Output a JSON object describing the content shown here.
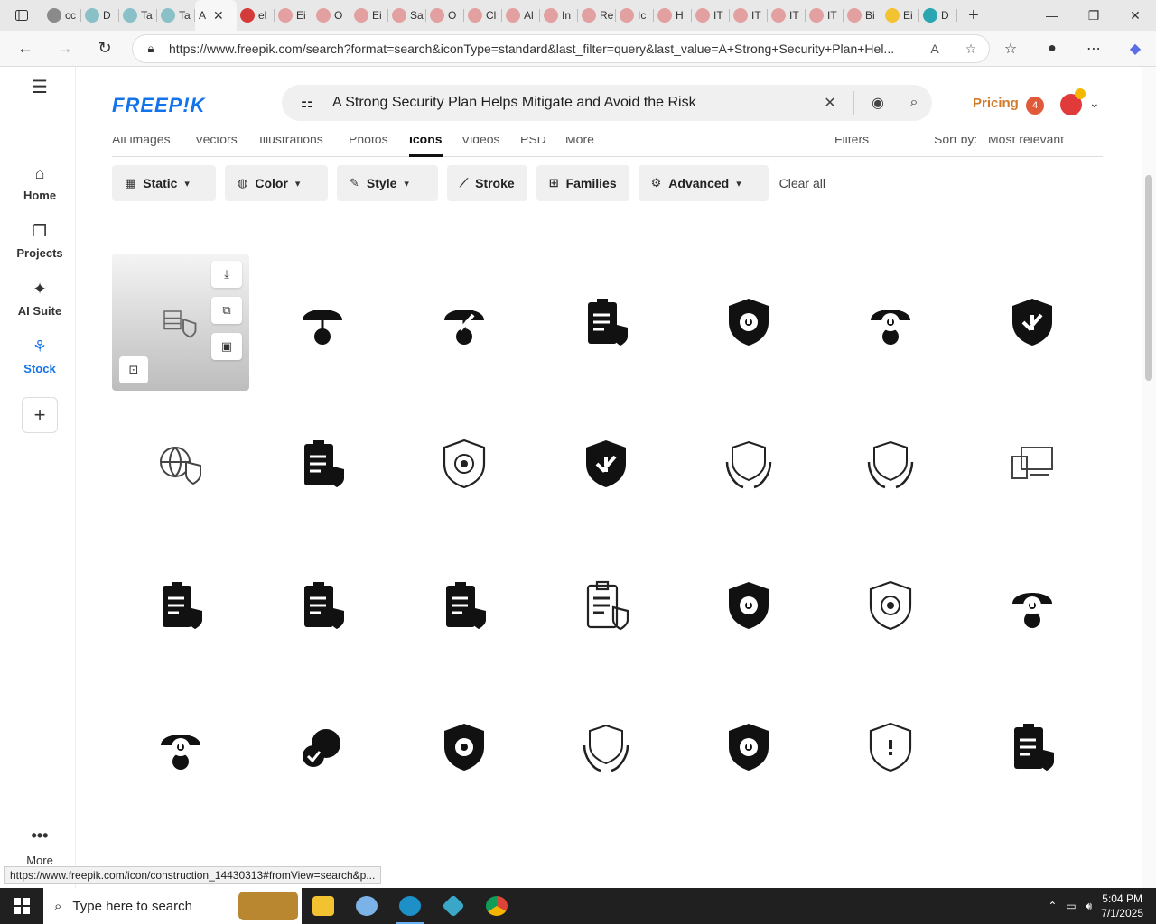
{
  "browser": {
    "tabs": [
      {
        "label": "cc",
        "color": "#8a8a8a"
      },
      {
        "label": "D",
        "color": "#8ac0c8"
      },
      {
        "label": "Ta",
        "color": "#8ac0c8"
      },
      {
        "label": "Ta",
        "color": "#8ac0c8"
      },
      {
        "label": "A",
        "color": "#ffffff",
        "active": true
      },
      {
        "label": "el",
        "color": "#d33a3a"
      },
      {
        "label": "Ei",
        "color": "#e3a0a0"
      },
      {
        "label": "O",
        "color": "#e3a0a0"
      },
      {
        "label": "Ei",
        "color": "#e3a0a0"
      },
      {
        "label": "Sa",
        "color": "#e3a0a0"
      },
      {
        "label": "O",
        "color": "#e3a0a0"
      },
      {
        "label": "Cl",
        "color": "#e3a0a0"
      },
      {
        "label": "Al",
        "color": "#e3a0a0"
      },
      {
        "label": "In",
        "color": "#e3a0a0"
      },
      {
        "label": "Re",
        "color": "#e3a0a0"
      },
      {
        "label": "Ic",
        "color": "#e3a0a0"
      },
      {
        "label": "H",
        "color": "#e3a0a0"
      },
      {
        "label": "IT",
        "color": "#e3a0a0"
      },
      {
        "label": "IT",
        "color": "#e3a0a0"
      },
      {
        "label": "IT",
        "color": "#e3a0a0"
      },
      {
        "label": "IT",
        "color": "#e3a0a0"
      },
      {
        "label": "Bi",
        "color": "#e3a0a0"
      },
      {
        "label": "Ei",
        "color": "#f2c230"
      },
      {
        "label": "D",
        "color": "#2aa6b0"
      }
    ],
    "new_tab": "+",
    "url": "https://www.freepik.com/search?format=search&iconType=standard&last_filter=query&last_value=A+Strong+Security+Plan+Hel...",
    "status_url": "https://www.freepik.com/icon/construction_14430313#fromView=search&p..."
  },
  "sidebar": {
    "items": [
      {
        "label": "Home",
        "icon": "⌂"
      },
      {
        "label": "Projects",
        "icon": "❐"
      },
      {
        "label": "AI Suite",
        "icon": "✦"
      },
      {
        "label": "Stock",
        "icon": "⚘"
      }
    ],
    "more_label": "More",
    "accent": "#1273eb"
  },
  "header": {
    "logo": "FREEP!K",
    "search_value": "A Strong Security Plan Helps Mitigate and Avoid the Risk",
    "pricing": "Pricing",
    "notif_count": "4"
  },
  "subtabs": {
    "items": [
      "All images",
      "Vectors",
      "Illustrations",
      "Photos",
      "Icons",
      "Videos",
      "PSD",
      "More"
    ],
    "active": "Icons",
    "filters_label": "Filters",
    "sort_label": "Sort by:",
    "sort_value": "Most relevant"
  },
  "filters": [
    {
      "label": "Static",
      "icon": "▦",
      "chev": true
    },
    {
      "label": "Color",
      "icon": "◍",
      "chev": true
    },
    {
      "label": "Style",
      "icon": "✎",
      "chev": true
    },
    {
      "label": "Stroke",
      "icon": "⟋",
      "chev": false
    },
    {
      "label": "Families",
      "icon": "⊞",
      "chev": false
    },
    {
      "label": "Advanced",
      "icon": "⚙",
      "chev": true
    }
  ],
  "clear_all": "Clear all",
  "icon_results": [
    [
      "construction-shield-icon",
      "umbrella-strategy-icon",
      "umbrella-shield-checklist-icon",
      "warning-checklist-icon",
      "shield-gear-warning-icon",
      "gear-umbrella-warning-icon",
      "shield-check-warning-icon"
    ],
    [
      "globe-shield-icon",
      "shield-checklist-icon",
      "shield-gear-outline-icon",
      "shield-check-warning-badge-icon",
      "hands-shield-outline-icon",
      "hands-shield-outline-icon",
      "shield-devices-icon"
    ],
    [
      "clipboard-shield-icon",
      "clipboard-lock-icon",
      "checklist-shield-icon",
      "clipboard-leaf-icon",
      "hand-gear-warning-icon",
      "shield-gear-outline-icon",
      "umbrella-gear-warning-icon"
    ],
    [
      "umbrella-gear-warning-icon",
      "gears-warning-icon",
      "shield-gear-flag-icon",
      "hands-shield-small-icon",
      "shield-gear-warning-icon",
      "shield-warning-outline-icon",
      "document-shield-icon"
    ]
  ],
  "taskbar": {
    "search_placeholder": "Type here to search",
    "time": "5:04 PM",
    "date": "7/1/2025"
  }
}
